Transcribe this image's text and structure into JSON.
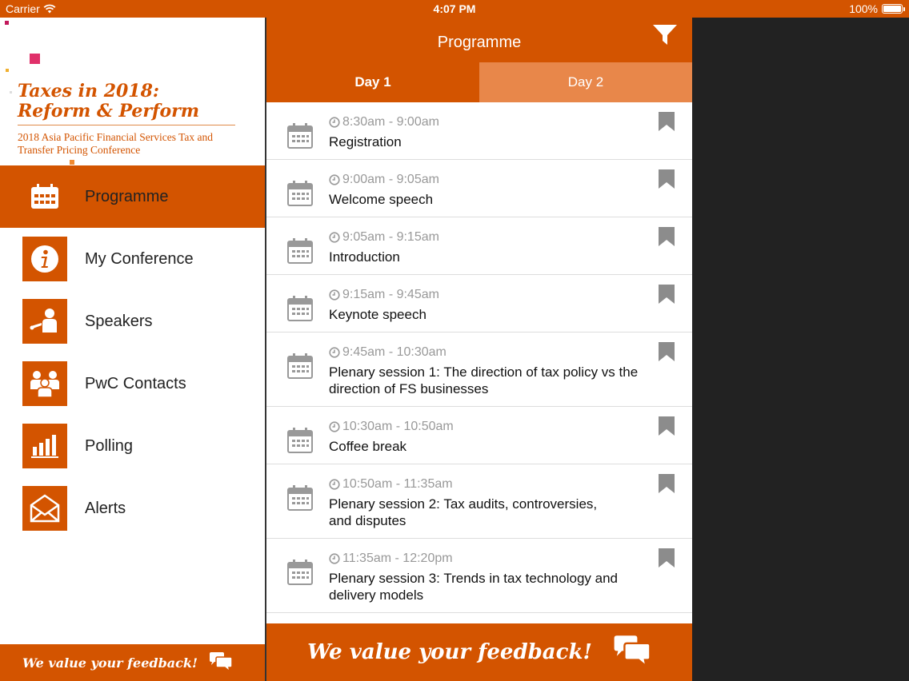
{
  "status_bar": {
    "carrier": "Carrier",
    "time": "4:07 PM",
    "battery": "100%"
  },
  "brand": {
    "title_line1": "Taxes in 2018:",
    "title_line2": "Reform & Perform",
    "subtitle": "2018 Asia Pacific Financial Services Tax and Transfer Pricing Conference"
  },
  "menu": {
    "items": [
      {
        "label": "Programme",
        "icon": "calendar-icon",
        "active": true
      },
      {
        "label": "My Conference",
        "icon": "info-icon",
        "active": false
      },
      {
        "label": "Speakers",
        "icon": "speaker-icon",
        "active": false
      },
      {
        "label": "PwC Contacts",
        "icon": "contacts-icon",
        "active": false
      },
      {
        "label": "Polling",
        "icon": "bar-chart-icon",
        "active": false
      },
      {
        "label": "Alerts",
        "icon": "envelope-icon",
        "active": false
      }
    ]
  },
  "feedback": {
    "label": "We value your feedback!",
    "icon": "chat-bubbles-icon"
  },
  "main": {
    "title": "Programme",
    "filter_icon": "filter-icon",
    "tabs": [
      {
        "label": "Day 1",
        "active": true
      },
      {
        "label": "Day 2",
        "active": false
      }
    ],
    "sessions": [
      {
        "time": "8:30am - 9:00am",
        "title": "Registration"
      },
      {
        "time": "9:00am - 9:05am",
        "title": "Welcome speech"
      },
      {
        "time": "9:05am - 9:15am",
        "title": "Introduction"
      },
      {
        "time": "9:15am - 9:45am",
        "title": "Keynote speech"
      },
      {
        "time": "9:45am - 10:30am",
        "title": "Plenary session 1: The direction of tax policy vs the direction of FS businesses"
      },
      {
        "time": "10:30am - 10:50am",
        "title": "Coffee break"
      },
      {
        "time": "10:50am - 11:35am",
        "title": "Plenary session 2: Tax audits, controversies, and disputes"
      },
      {
        "time": "11:35am - 12:20pm",
        "title": "Plenary session 3: Trends in tax technology and delivery models"
      }
    ]
  },
  "colors": {
    "accent": "#d35400",
    "tab_inactive": "#e8874a",
    "muted": "#999999"
  }
}
